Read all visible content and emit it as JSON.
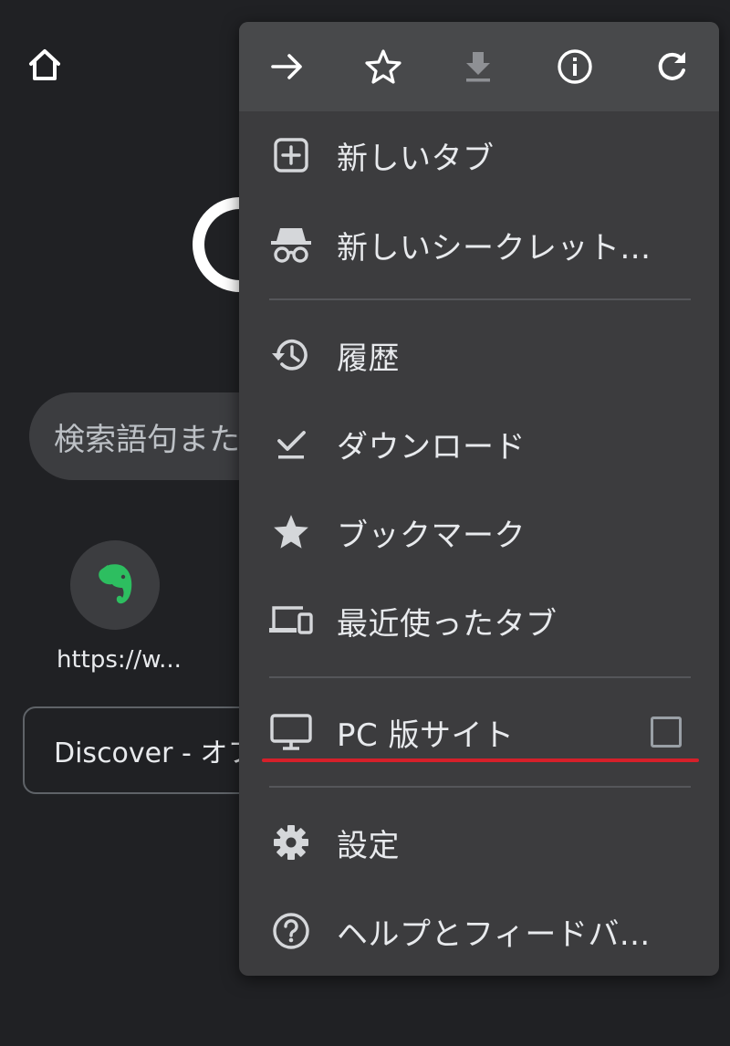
{
  "background": {
    "search_placeholder": "検索語句また",
    "shortcut_label": "https://w...",
    "discover_text": "Discover - オフ"
  },
  "toolbar": {
    "buttons": [
      {
        "icon": "forward-arrow-icon"
      },
      {
        "icon": "star-outline-icon"
      },
      {
        "icon": "download-icon"
      },
      {
        "icon": "info-icon"
      },
      {
        "icon": "refresh-icon"
      }
    ]
  },
  "menu": {
    "items": [
      {
        "label": "新しいタブ",
        "icon": "new-tab-icon"
      },
      {
        "label": "新しいシークレット...",
        "icon": "incognito-icon"
      },
      {
        "label": "履歴",
        "icon": "history-icon"
      },
      {
        "label": "ダウンロード",
        "icon": "downloads-check-icon"
      },
      {
        "label": "ブックマーク",
        "icon": "bookmark-star-icon"
      },
      {
        "label": "最近使ったタブ",
        "icon": "recent-tabs-icon"
      },
      {
        "label": "PC 版サイト",
        "icon": "desktop-icon",
        "checked": false
      },
      {
        "label": "設定",
        "icon": "settings-gear-icon"
      },
      {
        "label": "ヘルプとフィードバ...",
        "icon": "help-icon"
      }
    ]
  },
  "colors": {
    "page_background": "#202124",
    "menu_background": "#3c3c3e",
    "toolbar_background": "#48494b",
    "highlight_underline": "#d6202a",
    "evernote_green": "#2dbe60"
  }
}
